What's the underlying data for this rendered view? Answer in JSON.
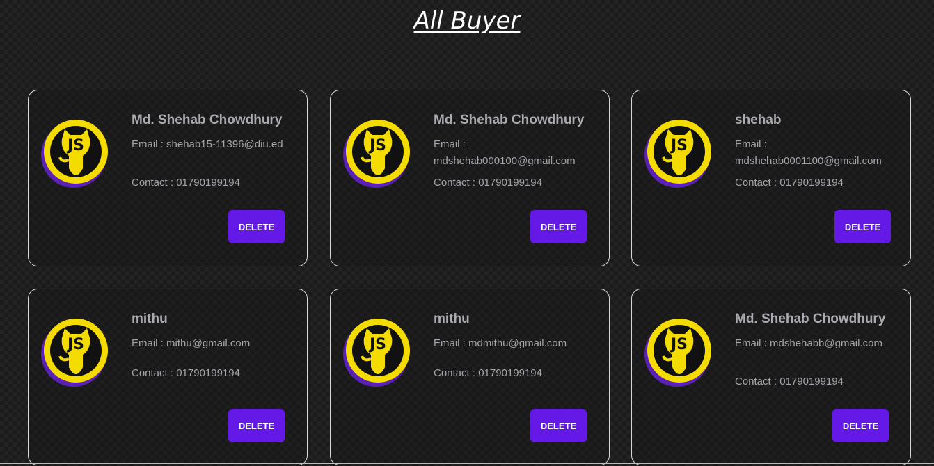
{
  "page": {
    "title": "All Buyer"
  },
  "avatar": {
    "icon": "js-octocat-icon",
    "text": "JS",
    "colors": {
      "ring": "#5b21b6",
      "badge": "#f5dc00",
      "inner": "#111111"
    }
  },
  "buttons": {
    "delete_label": "DELETE",
    "color": "#6419e6"
  },
  "buyers": [
    {
      "name": "Md. Shehab Chowdhury",
      "email": "Email : shehab15-11396@diu.ed",
      "contact": "Contact : 01790199194"
    },
    {
      "name": "Md. Shehab Chowdhury",
      "email": "Email : mdshehab000100@gmail.com",
      "contact": "Contact : 01790199194"
    },
    {
      "name": "shehab",
      "email": "Email : mdshehab0001100@gmail.com",
      "contact": "Contact : 01790199194"
    },
    {
      "name": "mithu",
      "email": "Email : mithu@gmail.com",
      "contact": "Contact : 01790199194"
    },
    {
      "name": "mithu",
      "email": "Email : mdmithu@gmail.com",
      "contact": "Contact : 01790199194"
    },
    {
      "name": "Md. Shehab Chowdhury",
      "email": "Email : mdshehabb@gmail.com",
      "contact": "Contact : 01790199194"
    }
  ]
}
